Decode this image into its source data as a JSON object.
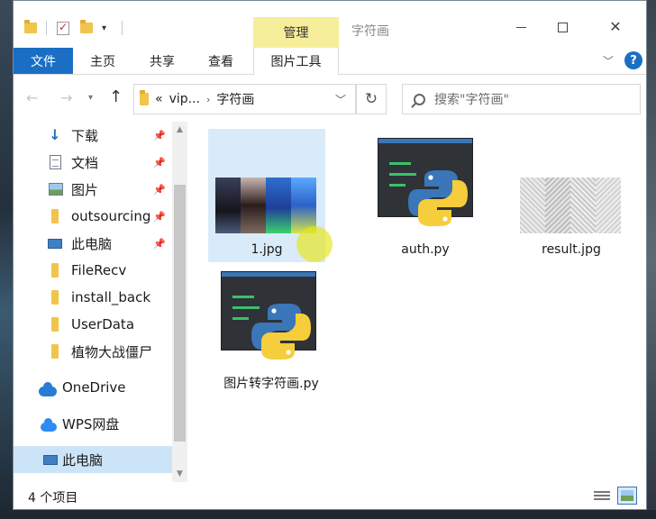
{
  "window": {
    "title": "字符画",
    "contextual_tab_group": "管理"
  },
  "ribbon": {
    "tabs": [
      "文件",
      "主页",
      "共享",
      "查看",
      "图片工具"
    ]
  },
  "address": {
    "overflow_marker": "«",
    "crumbs": [
      "vip...",
      "字符画"
    ],
    "search_placeholder": "搜索\"字符画\""
  },
  "sidebar": {
    "items": [
      {
        "label": "下载",
        "icon": "download-arrow-icon",
        "pinned": true
      },
      {
        "label": "文档",
        "icon": "document-icon",
        "pinned": true
      },
      {
        "label": "图片",
        "icon": "pictures-icon",
        "pinned": true
      },
      {
        "label": "outsourcing",
        "icon": "folder-icon",
        "pinned": true
      },
      {
        "label": "此电脑",
        "icon": "computer-icon",
        "pinned": true
      },
      {
        "label": "FileRecv",
        "icon": "folder-icon",
        "pinned": false
      },
      {
        "label": "install_back",
        "icon": "folder-icon",
        "pinned": false
      },
      {
        "label": "UserData",
        "icon": "folder-icon",
        "pinned": false
      },
      {
        "label": "植物大战僵尸",
        "icon": "folder-icon",
        "pinned": false
      },
      {
        "label": "OneDrive",
        "icon": "onedrive-cloud-icon",
        "pinned": false
      },
      {
        "label": "WPS网盘",
        "icon": "wps-cloud-icon",
        "pinned": false
      },
      {
        "label": "此电脑",
        "icon": "computer-icon",
        "pinned": false,
        "selected": true
      }
    ]
  },
  "files": [
    {
      "name": "1.jpg",
      "type": "image",
      "selected": true
    },
    {
      "name": "auth.py",
      "type": "python"
    },
    {
      "name": "result.jpg",
      "type": "image-grayscale"
    },
    {
      "name": "图片转字符画.py",
      "type": "python"
    }
  ],
  "status": {
    "item_count": "4 个项目"
  },
  "colors": {
    "accent": "#1a6fc4",
    "contextual_tab": "#f6ee9a",
    "selection": "#cce4f7",
    "python_blue": "#3a76b8",
    "python_yellow": "#f6cd3b"
  }
}
